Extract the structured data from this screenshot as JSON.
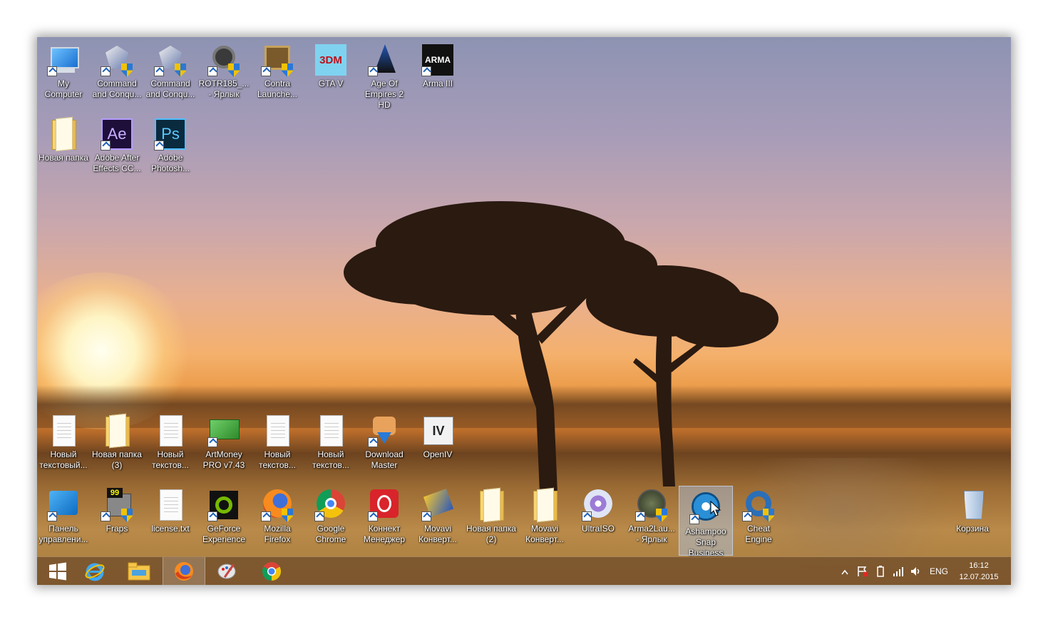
{
  "desktop": {
    "row1": [
      {
        "label": "My Computer",
        "icon": "my-computer-icon"
      },
      {
        "label": "Command and Conqu...",
        "icon": "command-and-conquer-icon"
      },
      {
        "label": "Command and Conqu...",
        "icon": "command-and-conquer-icon"
      },
      {
        "label": "ROTR185_... - Ярлык",
        "icon": "rotr-icon"
      },
      {
        "label": "Contra Launche...",
        "icon": "contra-launcher-icon"
      },
      {
        "label": "GTA V",
        "icon": "gta-v-icon",
        "badge": "3DM"
      },
      {
        "label": "Age Of Empires 2 HD",
        "icon": "age-of-empires-icon"
      },
      {
        "label": "Arma III",
        "icon": "arma-iii-icon",
        "badge": "ARMA"
      }
    ],
    "row2": [
      {
        "label": "Новая папка",
        "icon": "folder-icon"
      },
      {
        "label": "Adobe After Effects CC...",
        "icon": "after-effects-icon",
        "badge": "Ae"
      },
      {
        "label": "Adobe Photosh...",
        "icon": "photoshop-icon",
        "badge": "Ps"
      }
    ],
    "row3": [
      {
        "label": "Новый текстовый...",
        "icon": "text-document-icon"
      },
      {
        "label": "Новая папка (3)",
        "icon": "folder-icon"
      },
      {
        "label": "Новый текстов...",
        "icon": "text-document-icon"
      },
      {
        "label": "ArtMoney PRO v7.43",
        "icon": "artmoney-icon"
      },
      {
        "label": "Новый текстов...",
        "icon": "text-document-icon"
      },
      {
        "label": "Новый текстов...",
        "icon": "text-document-icon"
      },
      {
        "label": "Download Master",
        "icon": "download-master-icon"
      },
      {
        "label": "OpenIV",
        "icon": "openiv-icon",
        "badge": "IV"
      }
    ],
    "row4": [
      {
        "label": "Панель управлени...",
        "icon": "control-panel-icon"
      },
      {
        "label": "Fraps",
        "icon": "fraps-icon",
        "badge": "99"
      },
      {
        "label": "license.txt",
        "icon": "text-document-icon"
      },
      {
        "label": "GeForce Experience",
        "icon": "geforce-icon"
      },
      {
        "label": "Mozilla Firefox",
        "icon": "firefox-icon"
      },
      {
        "label": "Google Chrome",
        "icon": "chrome-icon"
      },
      {
        "label": "Коннект Менеджер",
        "icon": "connect-manager-icon"
      },
      {
        "label": "Movavi Конверт...",
        "icon": "movavi-icon"
      },
      {
        "label": "Новая папка (2)",
        "icon": "folder-icon"
      },
      {
        "label": "Movavi Конверт...",
        "icon": "folder-icon"
      },
      {
        "label": "UltraISO",
        "icon": "ultraiso-icon"
      },
      {
        "label": "Arma2Lau... - Ярлык",
        "icon": "arma2-launcher-icon"
      },
      {
        "label": "Ashampoo Snap Business",
        "icon": "ashampoo-snap-icon"
      },
      {
        "label": "Cheat Engine",
        "icon": "cheat-engine-icon"
      }
    ],
    "recycle_bin": {
      "label": "Корзина",
      "icon": "recycle-bin-icon"
    }
  },
  "taskbar": {
    "items": [
      {
        "name": "start-button",
        "icon": "windows-logo-icon"
      },
      {
        "name": "internet-explorer",
        "icon": "internet-explorer-icon"
      },
      {
        "name": "file-explorer",
        "icon": "file-explorer-icon"
      },
      {
        "name": "firefox",
        "icon": "firefox-icon",
        "active": true
      },
      {
        "name": "paint-app",
        "icon": "paint-icon"
      },
      {
        "name": "chrome",
        "icon": "chrome-icon"
      }
    ],
    "tray": {
      "language": "ENG",
      "time": "16:12",
      "date": "12.07.2015"
    }
  },
  "colors": {
    "taskbar": "#78522c",
    "selection": "#aac8f0",
    "sky_top": "#8e93b3",
    "sun": "#fff8c8"
  }
}
